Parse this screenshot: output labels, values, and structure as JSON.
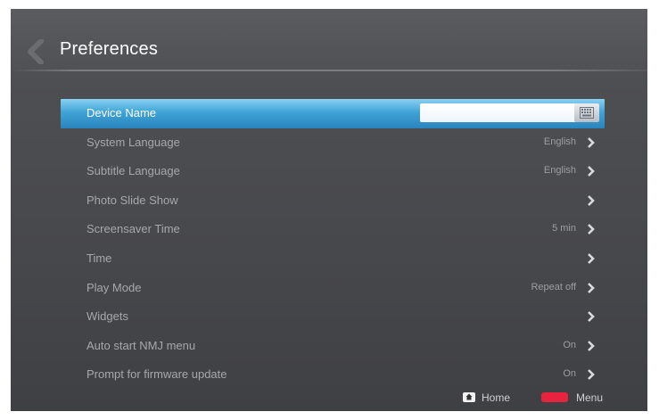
{
  "header": {
    "title": "Preferences"
  },
  "settings": {
    "items": [
      {
        "label": "Device Name",
        "value": "",
        "selected": true
      },
      {
        "label": "System Language",
        "value": "English"
      },
      {
        "label": "Subtitle Language",
        "value": "English"
      },
      {
        "label": "Photo Slide Show",
        "value": ""
      },
      {
        "label": "Screensaver Time",
        "value": "5 min"
      },
      {
        "label": "Time",
        "value": ""
      },
      {
        "label": "Play Mode",
        "value": "Repeat off"
      },
      {
        "label": "Widgets",
        "value": ""
      },
      {
        "label": "Auto start NMJ menu",
        "value": "On"
      },
      {
        "label": "Prompt for firmware update",
        "value": "On"
      }
    ]
  },
  "footer": {
    "home_label": "Home",
    "menu_label": "Menu",
    "menu_key_color": "#e8233f"
  },
  "icons": {
    "back": "back-arrow-icon",
    "keyboard": "keyboard-icon",
    "chevron": "chevron-right-icon",
    "home": "home-icon"
  },
  "colors": {
    "selection": "#3fa3d6",
    "background": "#4e4f52"
  }
}
